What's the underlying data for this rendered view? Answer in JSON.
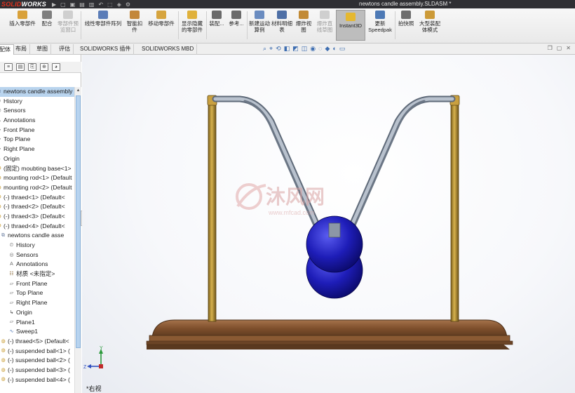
{
  "app": {
    "brand_left": "SOLID",
    "brand_right": "WORKS",
    "document_title": "newtons candle assembly.SLDASM *"
  },
  "ribbon": {
    "buttons": [
      {
        "label": "插入零部件",
        "enabled": true,
        "color": "#d9a13a"
      },
      {
        "label": "配合",
        "enabled": true,
        "color": "#7f7f7f"
      },
      {
        "label": "零部件预览窗口",
        "enabled": false,
        "color": "#bdbdbd"
      },
      {
        "label": "线性零部件阵列",
        "enabled": true,
        "color": "#5b7db8"
      },
      {
        "label": "智能扣件",
        "enabled": true,
        "color": "#c3873a"
      },
      {
        "label": "移动零部件",
        "enabled": true,
        "color": "#d6a43e"
      },
      {
        "label": "显示隐藏的零部件",
        "enabled": true,
        "color": "#e0b13b"
      },
      {
        "label": "装配...",
        "enabled": true,
        "color": "#6b6b6b"
      },
      {
        "label": "参考...",
        "enabled": true,
        "color": "#6b6b6b"
      },
      {
        "label": "新建运动算例",
        "enabled": true,
        "color": "#6a8cc0"
      },
      {
        "label": "材料明细表",
        "enabled": true,
        "color": "#4e6fa6"
      },
      {
        "label": "爆炸视图",
        "enabled": true,
        "color": "#c28a35"
      },
      {
        "label": "爆炸直线草图",
        "enabled": false,
        "color": "#bdbdbd"
      },
      {
        "label": "Instant3D",
        "enabled": true,
        "active": true,
        "color": "#e5b830"
      },
      {
        "label": "更新Speedpak",
        "enabled": true,
        "color": "#4d79b5"
      },
      {
        "label": "拍快照",
        "enabled": true,
        "color": "#6d6d6d"
      },
      {
        "label": "大型装配体模式",
        "enabled": true,
        "color": "#cc9a38"
      }
    ]
  },
  "tabs": [
    "装配体",
    "布局",
    "草图",
    "评估",
    "SOLIDWORKS 插件",
    "SOLIDWORKS MBD"
  ],
  "feature_tree": {
    "items": [
      {
        "label": "newtons candle assembly",
        "icon": "assembly-icon",
        "selected": true
      },
      {
        "label": "History",
        "icon": "history-icon"
      },
      {
        "label": "Sensors",
        "icon": "sensor-icon"
      },
      {
        "label": "Annotations",
        "icon": "annotation-icon"
      },
      {
        "label": "Front Plane",
        "icon": "plane-icon"
      },
      {
        "label": "Top Plane",
        "icon": "plane-icon"
      },
      {
        "label": "Right Plane",
        "icon": "plane-icon"
      },
      {
        "label": "Origin",
        "icon": "origin-icon"
      },
      {
        "label": "(固定) moubting base<1>",
        "icon": "part-icon"
      },
      {
        "label": "mounting rod<1> (Default",
        "icon": "part-icon"
      },
      {
        "label": "mounting rod<2> (Default",
        "icon": "part-icon"
      },
      {
        "label": "(-) thraed<1> (Default<",
        "icon": "part-icon"
      },
      {
        "label": "(-) thraed<2> (Default<",
        "icon": "part-icon"
      },
      {
        "label": "(-) thraed<3> (Default<",
        "icon": "part-icon"
      },
      {
        "label": "(-) thraed<4> (Default<",
        "icon": "part-icon"
      },
      {
        "label": "newtons candle asse",
        "icon": "assembly-icon"
      },
      {
        "label": "History",
        "icon": "history-icon"
      },
      {
        "label": "Sensors",
        "icon": "sensor-icon"
      },
      {
        "label": "Annotations",
        "icon": "annotation-icon"
      },
      {
        "label": "材质 <未指定>",
        "icon": "material-icon"
      },
      {
        "label": "Front Plane",
        "icon": "plane-icon"
      },
      {
        "label": "Top Plane",
        "icon": "plane-icon"
      },
      {
        "label": "Right Plane",
        "icon": "plane-icon"
      },
      {
        "label": "Origin",
        "icon": "origin-icon"
      },
      {
        "label": "Plane1",
        "icon": "plane-icon"
      },
      {
        "label": "Sweep1",
        "icon": "sweep-icon"
      },
      {
        "label": "(-) thraed<5> (Default<",
        "icon": "part-icon"
      },
      {
        "label": "(-) suspended ball<1> (",
        "icon": "part-icon"
      },
      {
        "label": "(-) suspended ball<2> (",
        "icon": "part-icon"
      },
      {
        "label": "(-) suspended ball<3> (",
        "icon": "part-icon"
      },
      {
        "label": "(-) suspended ball<4> (",
        "icon": "part-icon"
      }
    ]
  },
  "viewport": {
    "view_name": "*右视",
    "watermark": "沐风网",
    "watermark_url": "www.mfcad.com",
    "triad": {
      "x": "Y",
      "y": "Z"
    },
    "colors": {
      "base": "#8a5a33",
      "rod": "#b38a2e",
      "frame": "#8c97a6",
      "ball": "#1b1aa8"
    }
  }
}
